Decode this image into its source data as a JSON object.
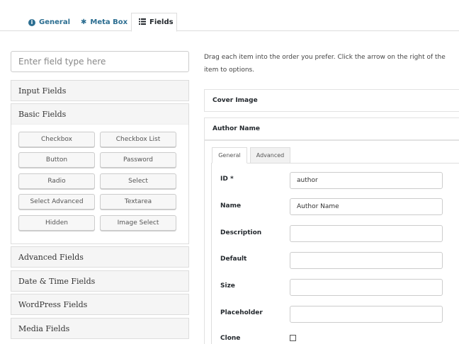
{
  "tabs": [
    {
      "label": "General",
      "icon": "info-icon"
    },
    {
      "label": "Meta Box",
      "icon": "gear-icon"
    },
    {
      "label": "Fields",
      "icon": "grid-icon",
      "active": true
    }
  ],
  "search": {
    "placeholder": "Enter field type here"
  },
  "groups": {
    "input": "Input Fields",
    "basic": "Basic Fields",
    "advanced": "Advanced Fields",
    "datetime": "Date & Time Fields",
    "wordpress": "WordPress Fields",
    "media": "Media Fields"
  },
  "basic_types": [
    "Checkbox",
    "Checkbox List",
    "Button",
    "Password",
    "Radio",
    "Select",
    "Select Advanced",
    "Textarea",
    "Hidden",
    "Image Select"
  ],
  "hint": "Drag each item into the order you prefer. Click the arrow on the right of the item to options.",
  "items": {
    "cover": "Cover Image",
    "author": "Author Name"
  },
  "inner_tabs": {
    "general": "General",
    "advanced": "Advanced"
  },
  "form": {
    "id_label": "ID *",
    "id_value": "author",
    "name_label": "Name",
    "name_value": "Author Name",
    "description_label": "Description",
    "description_value": "",
    "default_label": "Default",
    "default_value": "",
    "size_label": "Size",
    "size_value": "",
    "placeholder_label": "Placeholder",
    "placeholder_value": "",
    "clone_label": "Clone"
  }
}
